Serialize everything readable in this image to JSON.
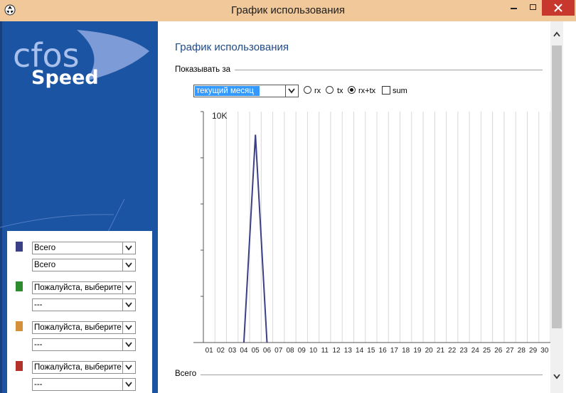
{
  "window": {
    "title": "График использования",
    "colors": {
      "titlebar": "#f0c89a",
      "close": "#c7372d",
      "panel": "#1c54a4"
    }
  },
  "logo": {
    "text1": "cfos",
    "text2": "Speed"
  },
  "legend": {
    "items": [
      {
        "color": "#3b3f86",
        "select1": "Всего",
        "select2": "Всего"
      },
      {
        "color": "#2e8b2e",
        "select1": "Пожалуйста, выберите",
        "select2": "---"
      },
      {
        "color": "#d4913a",
        "select1": "Пожалуйста, выберите",
        "select2": "---"
      },
      {
        "color": "#b3332b",
        "select1": "Пожалуйста, выберите",
        "select2": "---"
      }
    ]
  },
  "main": {
    "heading": "График использования",
    "show_for_label": "Показывать за",
    "period_value": "текущий месяц",
    "options": {
      "rx": "rx",
      "tx": "tx",
      "rxtx": "rx+tx",
      "sum": "sum"
    },
    "selected_option": "rx+tx",
    "sum_checked": false,
    "total_label": "Всего"
  },
  "chart_data": {
    "type": "line",
    "y_tick_label": "10K",
    "ylim": [
      0,
      10000
    ],
    "x": [
      "01",
      "02",
      "03",
      "04",
      "05",
      "06",
      "07",
      "08",
      "09",
      "10",
      "11",
      "12",
      "13",
      "14",
      "15",
      "16",
      "17",
      "18",
      "19",
      "20",
      "21",
      "22",
      "23",
      "24",
      "25",
      "26",
      "27",
      "28",
      "29",
      "30"
    ],
    "series": [
      {
        "color": "#3b3f86",
        "values": [
          0,
          0,
          0,
          0,
          9000,
          0,
          0,
          0,
          0,
          0,
          0,
          0,
          0,
          0,
          0,
          0,
          0,
          0,
          0,
          0,
          0,
          0,
          0,
          0,
          0,
          0,
          0,
          0,
          0,
          0
        ]
      }
    ],
    "grid": true
  }
}
